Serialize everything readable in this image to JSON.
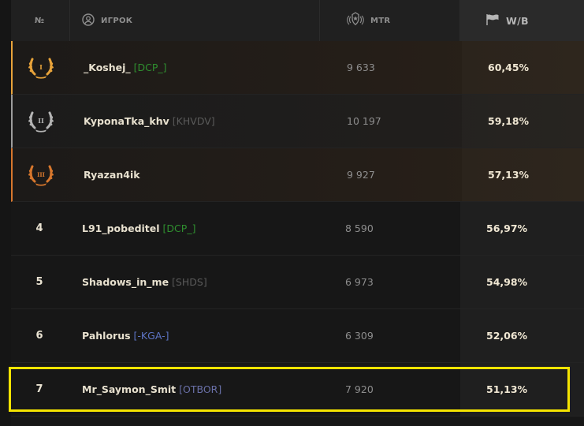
{
  "header": {
    "rank_label": "№",
    "player_label": "ИГРОК",
    "mtr_label": "MTR",
    "wr_label": "W/B",
    "player_icon": "user-circle-icon",
    "mtr_icon": "rating-emblem-icon",
    "wr_icon": "flag-icon"
  },
  "colors": {
    "gold": "#e8a33a",
    "silver": "#b4b4b4",
    "bronze": "#d7772d",
    "highlight": "#f5e400"
  },
  "rows": [
    {
      "rank": "I",
      "player": "_Koshej_",
      "tag": "[DCP_]",
      "tag_color": "#2f8f2f",
      "mtr": "9 633",
      "wr": "60,45%"
    },
    {
      "rank": "II",
      "player": "KyponaTka_khv",
      "tag": "[KHVDV]",
      "tag_color": "#5a5a5a",
      "mtr": "10 197",
      "wr": "59,18%"
    },
    {
      "rank": "III",
      "player": "Ryazan4ik",
      "tag": "",
      "tag_color": "#5a5a5a",
      "mtr": "9 927",
      "wr": "57,13%"
    },
    {
      "rank": "4",
      "player": "L91_pobeditel",
      "tag": "[DCP_]",
      "tag_color": "#2f8f2f",
      "mtr": "8 590",
      "wr": "56,97%"
    },
    {
      "rank": "5",
      "player": "Shadows_in_me",
      "tag": "[SHDS]",
      "tag_color": "#5a5a5a",
      "mtr": "6 973",
      "wr": "54,98%"
    },
    {
      "rank": "6",
      "player": "Pahlorus",
      "tag": "[-KGA-]",
      "tag_color": "#5d74c4",
      "mtr": "6 309",
      "wr": "52,06%"
    },
    {
      "rank": "7",
      "player": "Mr_Saymon_Smit",
      "tag": "[OTBOR]",
      "tag_color": "#6a70a8",
      "mtr": "7 920",
      "wr": "51,13%"
    }
  ]
}
